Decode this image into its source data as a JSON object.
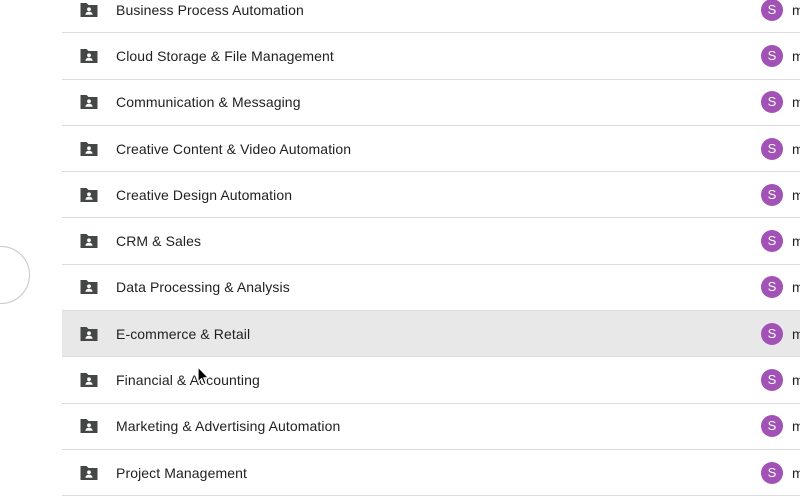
{
  "folders": [
    {
      "name": "Business Process Automation",
      "owner_initial": "S",
      "owner_text": "m"
    },
    {
      "name": "Cloud Storage & File Management",
      "owner_initial": "S",
      "owner_text": "m"
    },
    {
      "name": "Communication & Messaging",
      "owner_initial": "S",
      "owner_text": "m"
    },
    {
      "name": "Creative Content & Video Automation",
      "owner_initial": "S",
      "owner_text": "m"
    },
    {
      "name": "Creative Design Automation",
      "owner_initial": "S",
      "owner_text": "m"
    },
    {
      "name": "CRM & Sales",
      "owner_initial": "S",
      "owner_text": "m"
    },
    {
      "name": "Data Processing & Analysis",
      "owner_initial": "S",
      "owner_text": "m"
    },
    {
      "name": "E-commerce & Retail",
      "owner_initial": "S",
      "owner_text": "m"
    },
    {
      "name": "Financial & Accounting",
      "owner_initial": "S",
      "owner_text": "m"
    },
    {
      "name": "Marketing & Advertising Automation",
      "owner_initial": "S",
      "owner_text": "m"
    },
    {
      "name": "Project Management",
      "owner_initial": "S",
      "owner_text": "m"
    }
  ],
  "highlighted_row": "E-commerce & Retail",
  "colors": {
    "avatar": "#a251b6",
    "row_highlight": "#e8e8e8",
    "divider": "#dadce0",
    "icon": "#444746"
  },
  "icons": {
    "folder": "shared-folder-icon",
    "cursor": "mouse-pointer-icon"
  }
}
